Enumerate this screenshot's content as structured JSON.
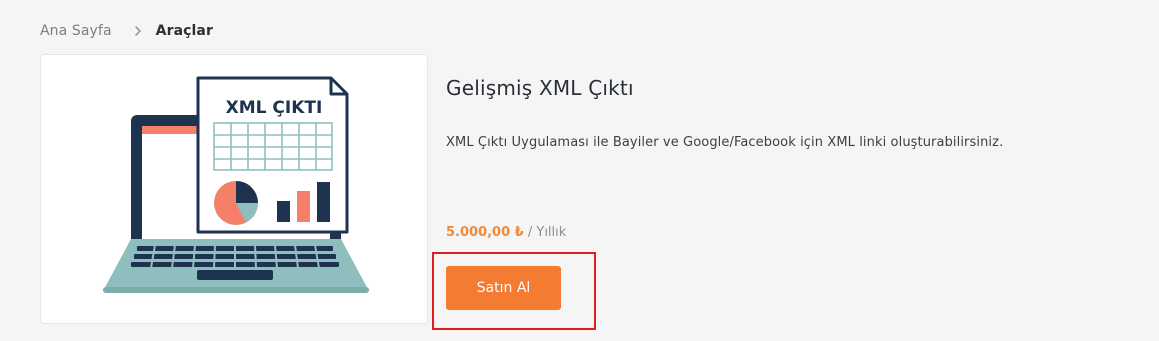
{
  "breadcrumb": {
    "home_label": "Ana Sayfa",
    "current_label": "Araçlar"
  },
  "product": {
    "image_text": "XML ÇIKTI",
    "title": "Gelişmiş XML Çıktı",
    "description": "XML Çıktı Uygulaması ile Bayiler ve Google/Facebook için XML linki oluşturabilirsiniz.",
    "price": "5.000,00 ₺",
    "period": " / Yıllık",
    "buy_label": "Satın Al"
  },
  "colors": {
    "accent": "#f47b32",
    "price": "#f08a3b",
    "highlight": "#e11d1d",
    "laptop_dark": "#1d3350",
    "laptop_teal": "#8ebfbe",
    "salmon": "#f5806a"
  }
}
